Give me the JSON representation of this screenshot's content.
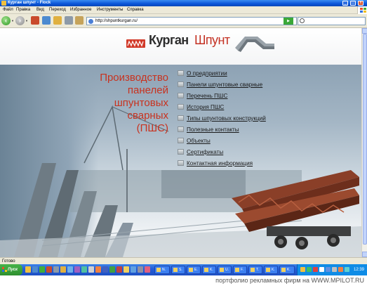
{
  "window": {
    "title": "Курган шпунт - Flock"
  },
  "menubar": {
    "items": [
      "Файл",
      "Правка",
      "Вид",
      "Переход",
      "Избранное",
      "Инструменты",
      "Справка"
    ]
  },
  "toolbar": {
    "address": "http://shpuntkurgan.ru/"
  },
  "site": {
    "logo_bold": "Курган",
    "logo_light": "Шпунт",
    "heading_lines": [
      "Производство",
      "панелей",
      "шпунтовых",
      "сварных",
      "(ПШС)"
    ],
    "menu": [
      "О предприятии",
      "Панели шпунтовые сварные",
      "Перечень ПШС",
      "История ПШС",
      "Типы шпунтовых конструкций",
      "Полезные контакты",
      "Объекты",
      "Сертификаты",
      "Контактная информация"
    ]
  },
  "statusbar": {
    "text": "Готово"
  },
  "taskbar": {
    "start_label": "Пуск",
    "tasks": [
      "N.",
      "S.",
      "E.",
      "K.",
      "U.",
      "F.",
      "T.",
      "K.",
      "K.",
      "V.",
      "K."
    ],
    "clock": "12:39"
  },
  "caption": {
    "text": "портфолио рекламных фирм на WWW.MPILOT.RU"
  },
  "colors": {
    "accent": "#c8321f",
    "xp_blue": "#245ed8",
    "xp_chrome": "#ece9d8"
  }
}
